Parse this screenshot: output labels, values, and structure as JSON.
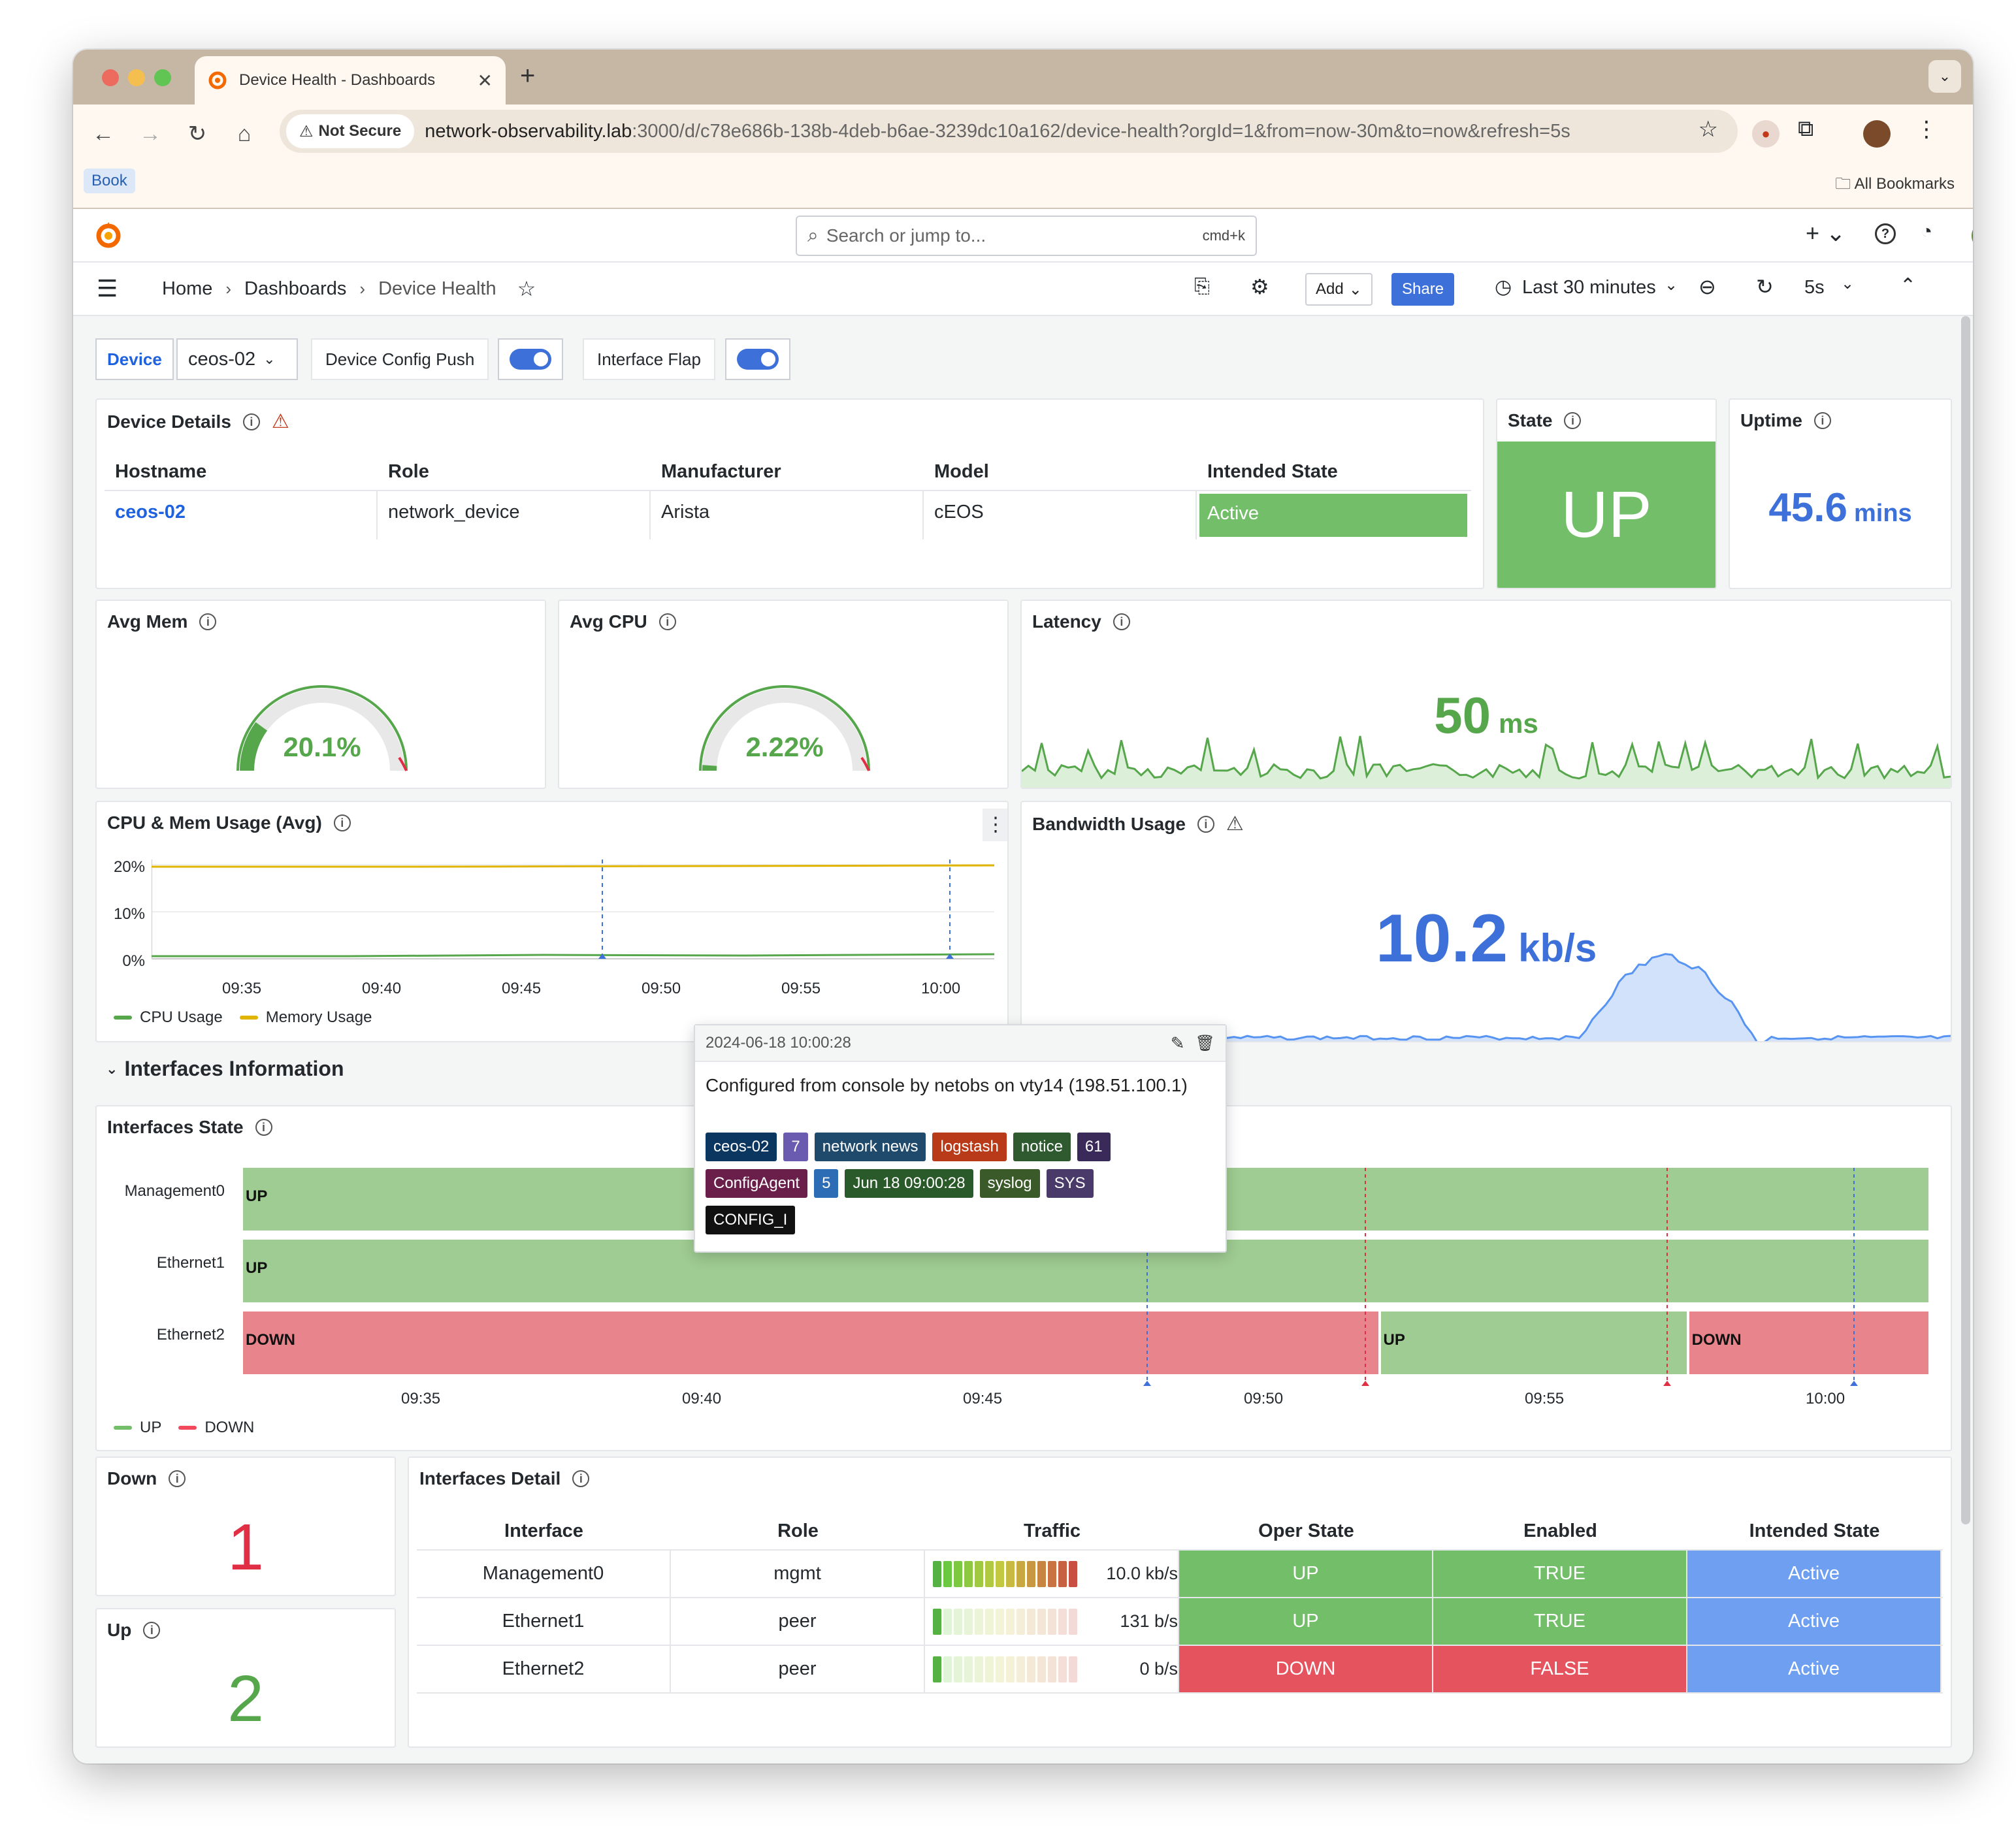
{
  "browser": {
    "tab_title": "Device Health - Dashboards",
    "security": "Not Secure",
    "url_host": "network-observability.lab",
    "url_rest": ":3000/d/c78e686b-138b-4deb-b6ae-3239dc10a162/device-health?orgId=1&from=now-30m&to=now&refresh=5s",
    "bookmark": "Book",
    "all_bookmarks": "All Bookmarks"
  },
  "topbar": {
    "search_placeholder": "Search or jump to...",
    "shortcut": "cmd+k"
  },
  "breadcrumb": {
    "home": "Home",
    "dashboards": "Dashboards",
    "current": "Device Health"
  },
  "toolbar": {
    "add": "Add",
    "share": "Share",
    "time_range": "Last 30 minutes",
    "refresh": "5s"
  },
  "variables": {
    "device_label": "Device",
    "device_value": "ceos-02",
    "config_push": "Device Config Push",
    "interface_flap": "Interface Flap"
  },
  "device_details": {
    "title": "Device Details",
    "headers": [
      "Hostname",
      "Role",
      "Manufacturer",
      "Model",
      "Intended State"
    ],
    "row": [
      "ceos-02",
      "network_device",
      "Arista",
      "cEOS",
      "Active"
    ]
  },
  "state": {
    "title": "State",
    "value": "UP"
  },
  "uptime": {
    "title": "Uptime",
    "value": "45.6",
    "unit": "mins"
  },
  "avg_mem": {
    "title": "Avg Mem",
    "value": "20.1%",
    "fraction": 0.201
  },
  "avg_cpu": {
    "title": "Avg CPU",
    "value": "2.22%",
    "fraction": 0.0222
  },
  "latency": {
    "title": "Latency",
    "value": "50",
    "unit": "ms"
  },
  "cpu_mem": {
    "title": "CPU & Mem Usage (Avg)",
    "yticks": [
      "20%",
      "10%",
      "0%"
    ],
    "xticks": [
      "09:35",
      "09:40",
      "09:45",
      "09:50",
      "09:55",
      "10:00"
    ],
    "legend": [
      "CPU Usage",
      "Memory Usage"
    ]
  },
  "bandwidth": {
    "title": "Bandwidth Usage",
    "value": "10.2",
    "unit": "kb/s"
  },
  "annotation": {
    "time": "2024-06-18 10:00:28",
    "message": "Configured from console by netobs on vty14 (198.51.100.1)",
    "tags_row1": [
      "ceos-02",
      "7",
      "network news",
      "logstash",
      "notice",
      "61"
    ],
    "tags_row2": [
      "ConfigAgent",
      "5",
      "Jun 18 09:00:28",
      "syslog",
      "SYS"
    ],
    "tags_row3": [
      "CONFIG_I"
    ]
  },
  "section": {
    "title": "Interfaces Information"
  },
  "interfaces_state": {
    "title": "Interfaces State",
    "rows": [
      {
        "name": "Management0",
        "segments": [
          {
            "label": "UP",
            "state": "up",
            "from": 0,
            "to": 1
          }
        ]
      },
      {
        "name": "Ethernet1",
        "segments": [
          {
            "label": "UP",
            "state": "up",
            "from": 0,
            "to": 1
          }
        ]
      },
      {
        "name": "Ethernet2",
        "segments": [
          {
            "label": "DOWN",
            "state": "down",
            "from": 0,
            "to": 0.675
          },
          {
            "label": "UP",
            "state": "up",
            "from": 0.675,
            "to": 0.858
          },
          {
            "label": "DOWN",
            "state": "down",
            "from": 0.858,
            "to": 1
          }
        ]
      }
    ],
    "xticks": [
      "09:35",
      "09:40",
      "09:45",
      "09:50",
      "09:55",
      "10:00"
    ],
    "legend": [
      "UP",
      "DOWN"
    ]
  },
  "down": {
    "title": "Down",
    "value": "1"
  },
  "up": {
    "title": "Up",
    "value": "2"
  },
  "interfaces_detail": {
    "title": "Interfaces Detail",
    "headers": [
      "Interface",
      "Role",
      "Traffic",
      "Oper State",
      "Enabled",
      "Intended State"
    ],
    "rows": [
      {
        "interface": "Management0",
        "role": "mgmt",
        "traffic": "10.0 kb/s",
        "gauge": 1.0,
        "oper": "UP",
        "enabled": "TRUE",
        "intended": "Active"
      },
      {
        "interface": "Ethernet1",
        "role": "peer",
        "traffic": "131 b/s",
        "gauge": 0.05,
        "oper": "UP",
        "enabled": "TRUE",
        "intended": "Active"
      },
      {
        "interface": "Ethernet2",
        "role": "peer",
        "traffic": "0 b/s",
        "gauge": 0.05,
        "oper": "DOWN",
        "enabled": "FALSE",
        "intended": "Active"
      }
    ]
  },
  "colors": {
    "green": "#73bf69",
    "red": "#f2495c",
    "blue": "#5794f2",
    "link": "#1f62e0"
  }
}
